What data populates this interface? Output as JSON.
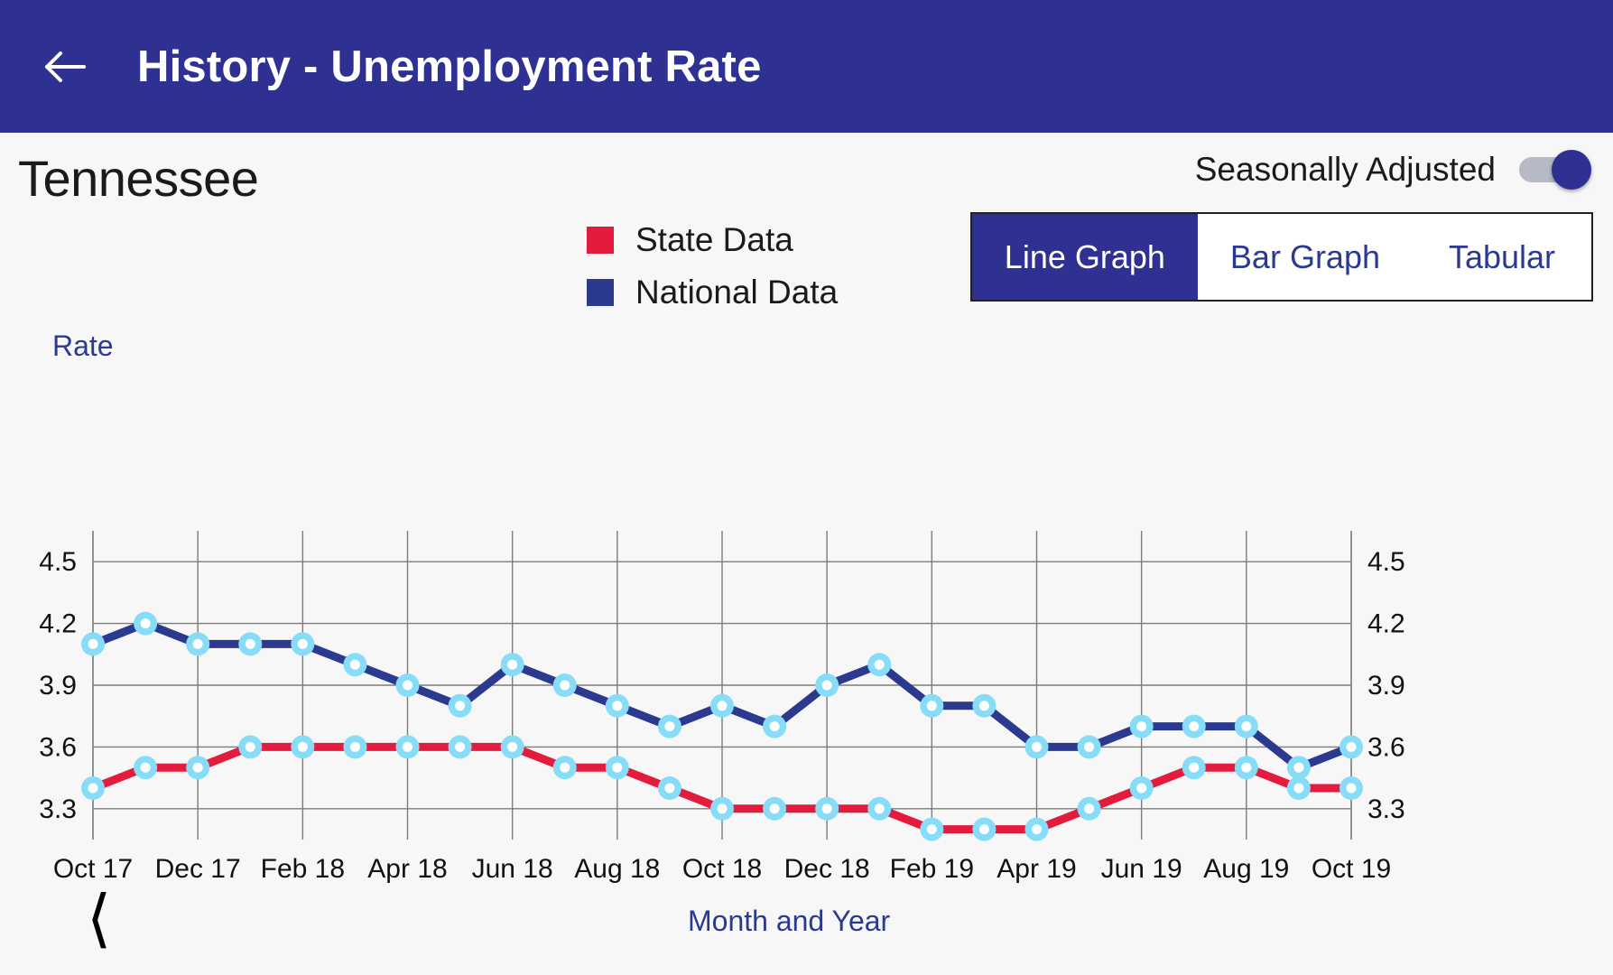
{
  "app_bar": {
    "back_icon": "arrow-left-icon",
    "title": "History - Unemployment Rate"
  },
  "header": {
    "state_name": "Tennessee",
    "seasonally_adjusted_label": "Seasonally Adjusted",
    "seasonally_adjusted_on": true
  },
  "view_switcher": {
    "tabs": [
      {
        "label": "Line Graph",
        "active": true
      },
      {
        "label": "Bar Graph",
        "active": false
      },
      {
        "label": "Tabular",
        "active": false
      }
    ]
  },
  "legend": [
    {
      "label": "State Data",
      "color": "#e31b3d"
    },
    {
      "label": "National Data",
      "color": "#2b3a8f"
    }
  ],
  "footer": {
    "prev_chevron": "chevron-left-icon"
  },
  "colors": {
    "app_bar": "#2e3192",
    "accent_blue": "#2b3a8f",
    "state_red": "#e31b3d",
    "national_navy": "#2b3a8f",
    "marker_ring": "#87dcf7",
    "page_bg": "#f7f7f7",
    "gridline": "#7c7c7c"
  },
  "chart_data": {
    "type": "line",
    "title": "",
    "xlabel": "Month and Year",
    "ylabel": "Rate",
    "ylim": [
      3.15,
      4.65
    ],
    "yticks": [
      3.3,
      3.6,
      3.9,
      4.2,
      4.5
    ],
    "ytick_labels": [
      "3.3",
      "3.6",
      "3.9",
      "4.2",
      "4.5"
    ],
    "y_axis_both_sides": true,
    "grid": true,
    "legend_position": "top-center",
    "x": [
      "Oct 17",
      "Nov 17",
      "Dec 17",
      "Jan 18",
      "Feb 18",
      "Mar 18",
      "Apr 18",
      "May 18",
      "Jun 18",
      "Jul 18",
      "Aug 18",
      "Sep 18",
      "Oct 18",
      "Nov 18",
      "Dec 18",
      "Jan 19",
      "Feb 19",
      "Mar 19",
      "Apr 19",
      "May 19",
      "Jun 19",
      "Jul 19",
      "Aug 19",
      "Sep 19",
      "Oct 19"
    ],
    "xtick_labels": [
      "Oct 17",
      "Dec 17",
      "Feb 18",
      "Apr 18",
      "Jun 18",
      "Aug 18",
      "Oct 18",
      "Dec 18",
      "Feb 19",
      "Apr 19",
      "Jun 19",
      "Aug 19",
      "Oct 19"
    ],
    "xtick_indices": [
      0,
      2,
      4,
      6,
      8,
      10,
      12,
      14,
      16,
      18,
      20,
      22,
      24
    ],
    "series": [
      {
        "name": "State Data",
        "color": "#e31b3d",
        "values": [
          3.4,
          3.5,
          3.5,
          3.6,
          3.6,
          3.6,
          3.6,
          3.6,
          3.6,
          3.5,
          3.5,
          3.4,
          3.3,
          3.3,
          3.3,
          3.3,
          3.2,
          3.2,
          3.2,
          3.3,
          3.4,
          3.5,
          3.5,
          3.4,
          3.4
        ]
      },
      {
        "name": "National Data",
        "color": "#2b3a8f",
        "values": [
          4.1,
          4.2,
          4.1,
          4.1,
          4.1,
          4.0,
          3.9,
          3.8,
          4.0,
          3.9,
          3.8,
          3.7,
          3.8,
          3.7,
          3.9,
          4.0,
          3.8,
          3.8,
          3.6,
          3.6,
          3.7,
          3.7,
          3.7,
          3.5,
          3.6
        ]
      }
    ]
  }
}
